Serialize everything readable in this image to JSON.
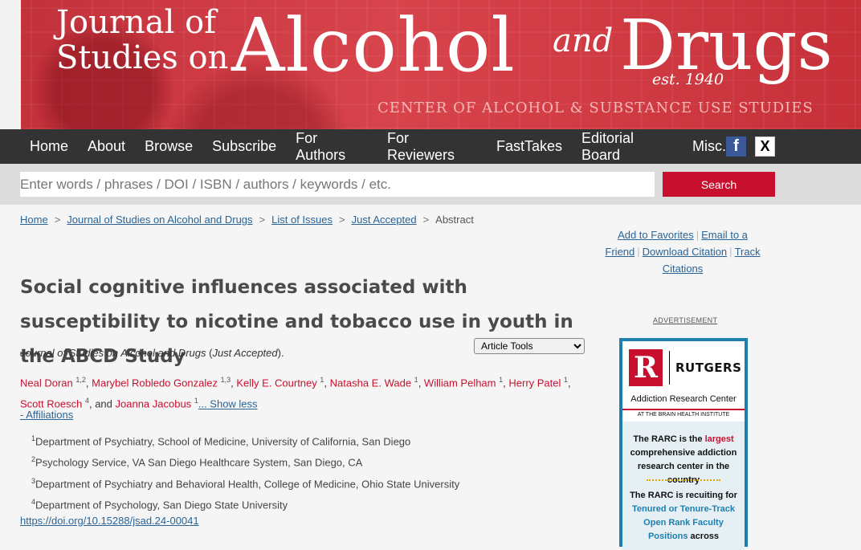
{
  "banner": {
    "title_left_line1": "Journal of",
    "title_left_line2": "Studies on",
    "title_big1": "Alcohol",
    "title_and": "and",
    "title_big2": "Drugs",
    "est": "est. 1940",
    "subtitle": "CENTER OF ALCOHOL & SUBSTANCE USE STUDIES"
  },
  "nav": {
    "items": [
      "Home",
      "About",
      "Browse",
      "Subscribe",
      "For Authors",
      "For Reviewers",
      "FastTakes",
      "Editorial Board",
      "Misc."
    ],
    "facebook": "f",
    "x": "X"
  },
  "search": {
    "placeholder": "Enter words / phrases / DOI / ISBN / authors / keywords / etc.",
    "button_label": "Search"
  },
  "breadcrumb": {
    "items": [
      "Home",
      "Journal of Studies on Alcohol and Drugs",
      "List of Issues",
      "Just Accepted"
    ],
    "current": "Abstract",
    "separator": ">"
  },
  "actions": {
    "add_favorites": "Add to Favorites",
    "email_friend": "Email to a Friend",
    "download_citation": "Download Citation",
    "track_citations": "Track Citations"
  },
  "article": {
    "title": "Social cognitive influences associated with susceptibility to nicotine and tobacco use in youth in the ABCD Study",
    "journal": "Journal of Studies on Alcohol and Drugs",
    "status": "Just Accepted",
    "tools_label": "Article Tools",
    "authors": [
      {
        "name": "Neal Doran",
        "aff": "1,2"
      },
      {
        "name": "Marybel Robledo Gonzalez",
        "aff": "1,3"
      },
      {
        "name": "Kelly E. Courtney",
        "aff": "1"
      },
      {
        "name": "Natasha E. Wade",
        "aff": "1"
      },
      {
        "name": "William Pelham",
        "aff": "1"
      },
      {
        "name": "Herry Patel",
        "aff": "1"
      },
      {
        "name": "Scott Roesch",
        "aff": "4"
      },
      {
        "name": "Joanna Jacobus",
        "aff": "1"
      }
    ],
    "and_word": ", and",
    "show_less": "... Show less",
    "affiliations_toggle": "- Affiliations",
    "affiliations": [
      {
        "num": "1",
        "text": "Department of Psychiatry, School of Medicine, University of California, San Diego"
      },
      {
        "num": "2",
        "text": "Psychology Service, VA San Diego Healthcare System, San Diego, CA"
      },
      {
        "num": "3",
        "text": "Department of Psychiatry and Behavioral Health, College of Medicine, Ohio State University"
      },
      {
        "num": "4",
        "text": "Department of Psychology, San Diego State University"
      }
    ],
    "doi": "https://doi.org/10.15288/jsad.24-00041"
  },
  "ad": {
    "label": "ADVERTISEMENT",
    "logo_letter": "R",
    "logo_text": "RUTGERS",
    "center_name": "Addiction Research Center",
    "center_sub": "AT THE BRAIN HEALTH INSTITUTE",
    "p1_a": "The RARC is the",
    "p1_hl": "largest",
    "p1_b": "comprehensive addiction research center in the country",
    "p2_a": "The RARC is recuiting for",
    "p2_bl": "Tenured or Tenure-Track Open Rank Faculty Positions",
    "p2_b": "across"
  }
}
